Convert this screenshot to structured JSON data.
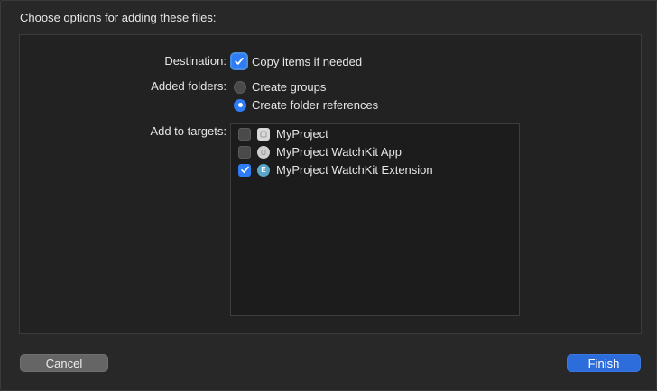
{
  "dialog": {
    "title": "Choose options for adding these files:"
  },
  "destination": {
    "label": "Destination:",
    "option_label": "Copy items if needed",
    "checked": true
  },
  "added_folders": {
    "label": "Added folders:",
    "options": [
      {
        "label": "Create groups",
        "selected": false
      },
      {
        "label": "Create folder references",
        "selected": true
      }
    ]
  },
  "targets": {
    "label": "Add to targets:",
    "items": [
      {
        "name": "MyProject",
        "checked": false,
        "icon": "app-icon"
      },
      {
        "name": "MyProject WatchKit App",
        "checked": false,
        "icon": "watchkit-app-icon"
      },
      {
        "name": "MyProject WatchKit Extension",
        "checked": true,
        "icon": "extension-icon",
        "icon_letter": "E"
      }
    ]
  },
  "buttons": {
    "cancel": "Cancel",
    "finish": "Finish"
  },
  "colors": {
    "accent": "#2e7cf6",
    "finish_button": "#2c6ddb",
    "cancel_button": "#656565",
    "background": "#282828"
  }
}
